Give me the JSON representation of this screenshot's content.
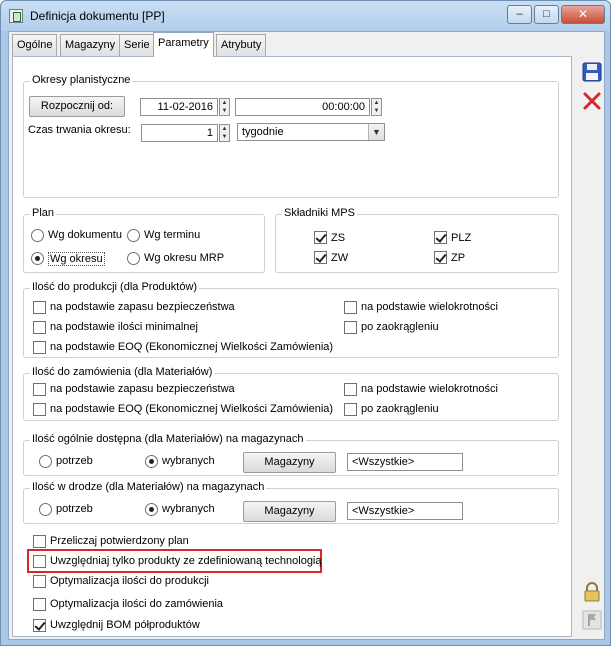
{
  "window": {
    "title": "Definicja dokumentu [PP]",
    "minimize": "–",
    "maximize": "□",
    "close": "✕"
  },
  "tabs": [
    "Ogólne",
    "Magazyny",
    "Serie",
    "Parametry",
    "Atrybuty"
  ],
  "active_tab": "Parametry",
  "okresy": {
    "legend": "Okresy planistyczne",
    "start_button": "Rozpocznij od:",
    "date": "11-02-2016",
    "time": "00:00:00",
    "duration_label": "Czas trwania okresu:",
    "duration_value": "1",
    "duration_unit": "tygodnie"
  },
  "plan": {
    "legend": "Plan",
    "options": [
      {
        "label": "Wg dokumentu",
        "checked": false
      },
      {
        "label": "Wg terminu",
        "checked": false
      },
      {
        "label": "Wg okresu",
        "checked": true
      },
      {
        "label": "Wg okresu MRP",
        "checked": false
      }
    ]
  },
  "mps": {
    "legend": "Składniki MPS",
    "items": [
      {
        "label": "ZS",
        "checked": true
      },
      {
        "label": "PLZ",
        "checked": true
      },
      {
        "label": "ZW",
        "checked": true
      },
      {
        "label": "ZP",
        "checked": true
      }
    ]
  },
  "produkcja": {
    "legend": "Ilość do produkcji (dla Produktów)",
    "items": [
      {
        "label": "na podstawie zapasu bezpieczeństwa",
        "checked": false
      },
      {
        "label": "na podstawie ilości minimalnej",
        "checked": false
      },
      {
        "label": "na podstawie EOQ (Ekonomicznej Wielkości Zamówienia)",
        "checked": false
      },
      {
        "label": "na podstawie wielokrotności",
        "checked": false
      },
      {
        "label": "po zaokrągleniu",
        "checked": false
      }
    ]
  },
  "zamowienia": {
    "legend": "Ilość do zamówienia (dla Materiałów)",
    "items": [
      {
        "label": "na podstawie zapasu bezpieczeństwa",
        "checked": false
      },
      {
        "label": "na podstawie EOQ (Ekonomicznej Wielkości Zamówienia)",
        "checked": false
      },
      {
        "label": "na podstawie wielokrotności",
        "checked": false
      },
      {
        "label": "po zaokrągleniu",
        "checked": false
      }
    ]
  },
  "dostepna": {
    "legend": "Ilość ogólnie dostępna (dla Materiałów) na magazynach",
    "opt1": "potrzeb",
    "opt2": "wybranych",
    "selected": "wybranych",
    "button": "Magazyny",
    "value": "<Wszystkie>"
  },
  "w_drodze": {
    "legend": "Ilość w drodze (dla Materiałów) na magazynach",
    "opt1": "potrzeb",
    "opt2": "wybranych",
    "selected": "wybranych",
    "button": "Magazyny",
    "value": "<Wszystkie>"
  },
  "options": [
    {
      "label": "Przeliczaj potwierdzony plan",
      "checked": false
    },
    {
      "label": "Uwzględniaj tylko produkty ze zdefiniowaną technologią",
      "checked": false,
      "highlighted": true
    },
    {
      "label": "Optymalizacja ilości do produkcji",
      "checked": false
    },
    {
      "label": "Optymalizacja ilości do zamówienia",
      "checked": false
    },
    {
      "label": "Uwzględnij BOM półproduktów",
      "checked": true
    }
  ],
  "sidebar": {
    "save": "save-icon",
    "delete": "delete-icon",
    "lock": "lock-icon",
    "flag": "flag-icon"
  },
  "colors": {
    "highlight": "#d9252b",
    "delete": "#d42a2a",
    "save": "#2e5cb8"
  }
}
